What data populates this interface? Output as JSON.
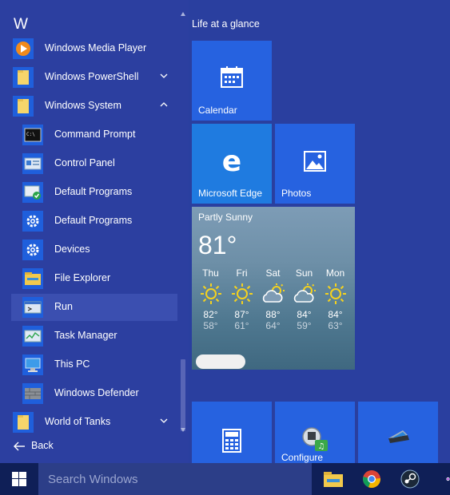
{
  "start_menu": {
    "section_letter": "W",
    "apps": [
      {
        "label": "Windows Media Player",
        "icon": "media-player-icon"
      },
      {
        "label": "Windows PowerShell",
        "icon": "folder-icon",
        "expandable": true
      },
      {
        "label": "Windows System",
        "icon": "folder-icon",
        "expanded": true
      },
      {
        "label": "Command Prompt",
        "icon": "command-prompt-icon"
      },
      {
        "label": "Control Panel",
        "icon": "control-panel-icon"
      },
      {
        "label": "Default Programs",
        "icon": "default-programs-icon"
      },
      {
        "label": "Default Programs",
        "icon": "gear-icon"
      },
      {
        "label": "Devices",
        "icon": "gear-icon"
      },
      {
        "label": "File Explorer",
        "icon": "file-explorer-icon"
      },
      {
        "label": "Run",
        "icon": "run-icon",
        "highlighted": true
      },
      {
        "label": "Task Manager",
        "icon": "task-manager-icon"
      },
      {
        "label": "This PC",
        "icon": "this-pc-icon"
      },
      {
        "label": "Windows Defender",
        "icon": "windows-defender-icon"
      },
      {
        "label": "World of Tanks",
        "icon": "folder-icon",
        "expandable": true
      }
    ],
    "back_label": "Back"
  },
  "tiles": {
    "group_title": "Life at a glance",
    "calendar_label": "Calendar",
    "edge_label": "Microsoft Edge",
    "photos_label": "Photos",
    "configure_label": "Configure"
  },
  "weather": {
    "condition": "Partly Sunny",
    "current_temp": "81°",
    "days": [
      {
        "name": "Thu",
        "icon": "sun-icon",
        "high": "82°",
        "low": "58°"
      },
      {
        "name": "Fri",
        "icon": "sun-icon",
        "high": "87°",
        "low": "61°"
      },
      {
        "name": "Sat",
        "icon": "partly-cloudy-icon",
        "high": "88°",
        "low": "64°"
      },
      {
        "name": "Sun",
        "icon": "partly-cloudy-icon",
        "high": "84°",
        "low": "59°"
      },
      {
        "name": "Mon",
        "icon": "sun-icon",
        "high": "84°",
        "low": "63°"
      }
    ]
  },
  "taskbar": {
    "search_placeholder": "Search Windows",
    "pinned": [
      "file-explorer-icon",
      "chrome-icon",
      "steam-icon",
      "app-icon"
    ]
  },
  "colors": {
    "accent": "#2662e0",
    "start_bg": "#2a3f9f",
    "taskbar_bg": "#0f1f57",
    "weather_sun": "#f5d21e"
  }
}
